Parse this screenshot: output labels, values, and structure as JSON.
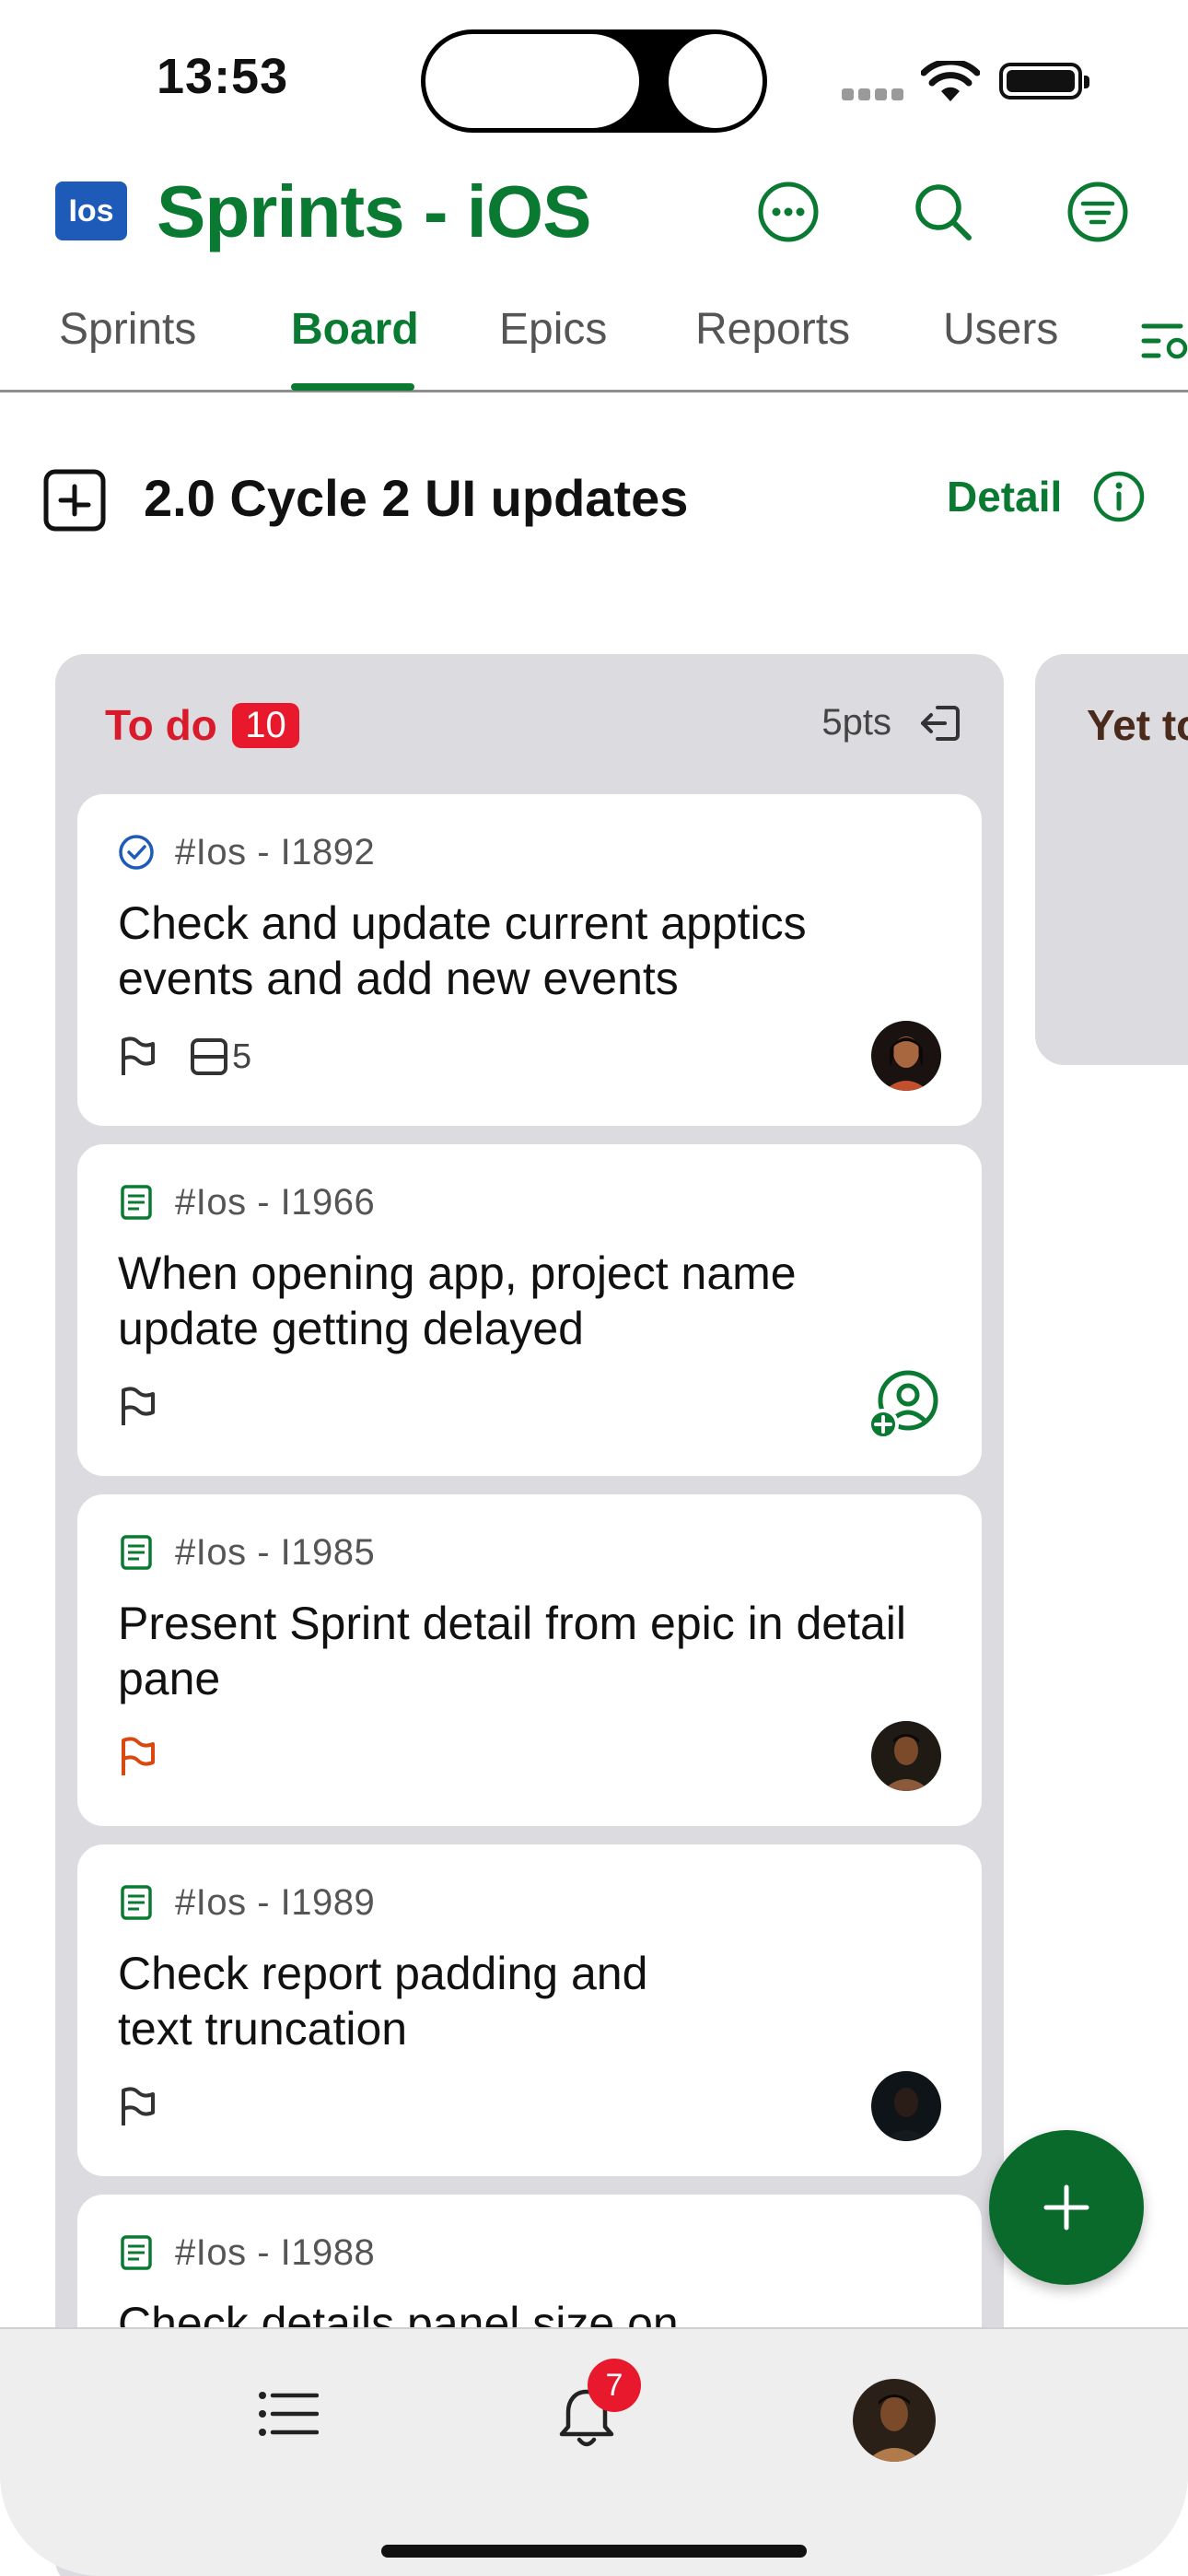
{
  "status": {
    "time": "13:53"
  },
  "header": {
    "logo_text": "Ios",
    "title": "Sprints - iOS",
    "icons": [
      "more-icon",
      "search-icon",
      "filter-icon"
    ]
  },
  "tabs": [
    {
      "label": "Sprints",
      "active": false
    },
    {
      "label": "Board",
      "active": true
    },
    {
      "label": "Epics",
      "active": false
    },
    {
      "label": "Reports",
      "active": false
    },
    {
      "label": "Users",
      "active": false
    }
  ],
  "sprint": {
    "title": "2.0 Cycle 2 UI updates",
    "detail_label": "Detail"
  },
  "columns": [
    {
      "title": "To do",
      "count": "10",
      "points": "5pts",
      "cards": [
        {
          "id": "#Ios - I1892",
          "type": "task-completed",
          "title": "Check and update current apptics events and add new events",
          "subtasks": "5",
          "flag": "default",
          "assignee": "avatar-1"
        },
        {
          "id": "#Ios - I1966",
          "type": "document",
          "title": "When opening app, project name update getting delayed",
          "subtasks": "",
          "flag": "default",
          "assignee": "unassigned"
        },
        {
          "id": "#Ios - I1985",
          "type": "document",
          "title": "Present Sprint detail from epic in detail pane",
          "subtasks": "",
          "flag": "orange",
          "assignee": "avatar-2"
        },
        {
          "id": "#Ios - I1989",
          "type": "document",
          "title": "Check report padding and text truncation",
          "subtasks": "",
          "flag": "default",
          "assignee": "avatar-3"
        },
        {
          "id": "#Ios - I1988",
          "type": "document",
          "title": "Check details panel size on",
          "subtasks": "",
          "flag": "default",
          "assignee": ""
        }
      ]
    },
    {
      "title": "Yet to",
      "count": "",
      "points": "",
      "cards": []
    }
  ],
  "bottom_nav": {
    "notification_count": "7",
    "items": [
      "list-icon",
      "bell-icon",
      "profile-avatar"
    ]
  },
  "colors": {
    "brand_green": "#0a7a32",
    "todo_red": "#d91a2a",
    "flag_orange": "#d9480f",
    "logo_blue": "#1e5bb8"
  }
}
